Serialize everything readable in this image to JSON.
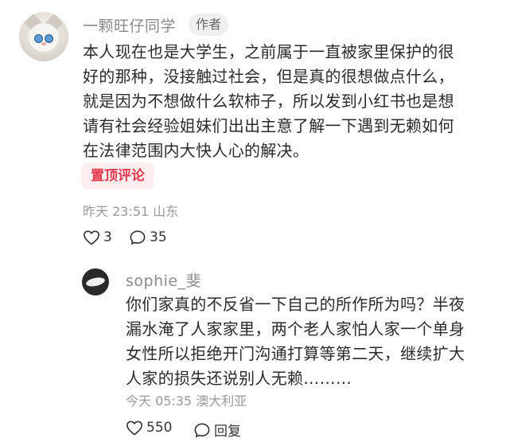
{
  "comment": {
    "username": "一颗旺仔同学",
    "author_tag": "作者",
    "text": "本人现在也是大学生，之前属于一直被家里保护的很\n好的那种，没接触过社会，但是真的很想做点什么，\n就是因为不想做什么软柿子，所以发到小红书也是想\n请有社会经验姐妹们出出主意了解一下遇到无赖如何\n在法律范围内大快人心的解决。",
    "pin_label": "置顶评论",
    "time": "昨天 23:51",
    "location": "山东",
    "likes": "3",
    "replies": "35",
    "avatar_icon": "cat-avatar"
  },
  "reply": {
    "username": "sophie_斐",
    "text": "你们家真的不反省一下自己的所作所为吗？半夜\n漏水淹了人家家里，两个老人家怕人家一个单身\n女性所以拒绝开门沟通打算等第二天，继续扩大\n人家的损失还说别人无赖………",
    "time": "今天 05:35",
    "location": "澳大利亚",
    "likes": "550",
    "reply_label": "回复",
    "avatar_icon": "user-avatar"
  },
  "colors": {
    "accent": "#e33b4f",
    "pin_bg": "#fdeef0",
    "meta_text": "#999999",
    "username_text": "#8a8a8a"
  }
}
